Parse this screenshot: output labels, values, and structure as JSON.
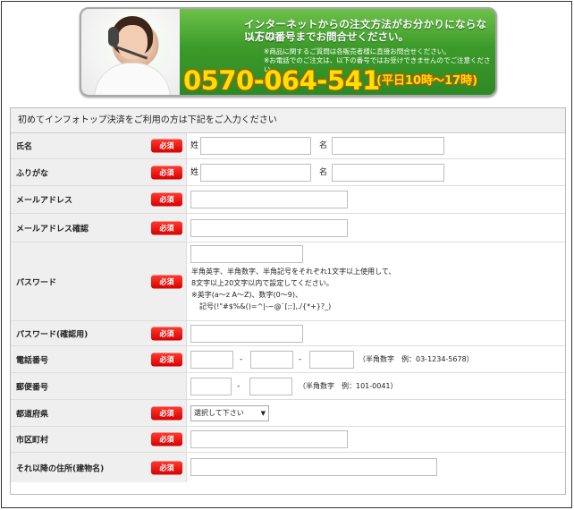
{
  "banner": {
    "headline1": "インターネットからの注文方法がお分かりにならない方は、",
    "headline2": "以下の番号までお問合せください。",
    "note1": "※商品に関するご質問は各販売者様に直接お問合せください。",
    "note2": "※お電話でのご注文は、以下の番号ではお受けできませんのでご注意ください。",
    "phone": "0570-064-541",
    "hours": "(平日10時～17時)"
  },
  "form": {
    "header": "初めてインフォトップ決済をご利用の方は下記をご入力ください",
    "required_label": "必須",
    "name": {
      "label": "氏名",
      "last": "姓",
      "first": "名"
    },
    "kana": {
      "label": "ふりがな",
      "last": "姓",
      "first": "名"
    },
    "email": {
      "label": "メールアドレス"
    },
    "email_confirm": {
      "label": "メールアドレス確認"
    },
    "password": {
      "label": "パスワード",
      "help1": "半角英字、半角数字、半角記号をそれぞれ1文字以上使用して、",
      "help2": "8文字以上20文字以内で設定してください。",
      "help3": "※英字(a～z A～Z)、数字(0～9)、",
      "help4": "記号(!\"#$%&()=^|-~@`[;:],./{*+}?_)"
    },
    "password_confirm": {
      "label": "パスワード(確認用)"
    },
    "phone": {
      "label": "電話番号",
      "sep1": "-",
      "sep2": "-",
      "hint": "（半角数字　例：03-1234-5678）"
    },
    "zip": {
      "label": "郵便番号",
      "sep": "-",
      "hint": "（半角数字　例：101-0041）"
    },
    "prefecture": {
      "label": "都道府県",
      "selected": "選択して下さい",
      "arrow": "▼"
    },
    "city": {
      "label": "市区町村"
    },
    "address": {
      "label": "それ以降の住所(建物名)"
    }
  }
}
